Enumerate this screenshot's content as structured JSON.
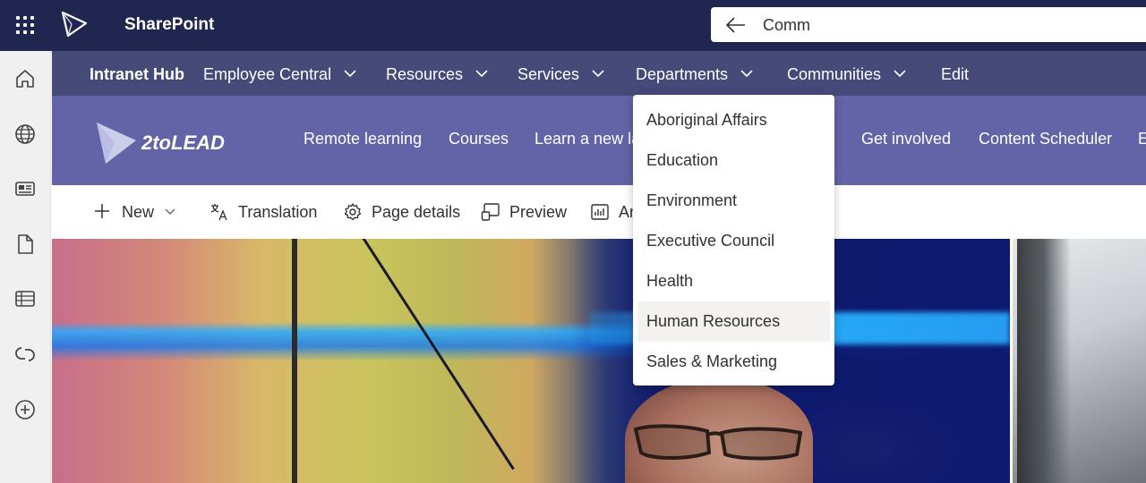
{
  "suite_bar": {
    "app_title": "SharePoint",
    "search_value": "Comm",
    "color": "#212650"
  },
  "app_bar": {
    "icons": [
      "home-icon",
      "globe-icon",
      "news-icon",
      "file-icon",
      "list-icon",
      "loop-icon",
      "add-circle-icon"
    ]
  },
  "hub_nav": {
    "title": "Intranet Hub",
    "items": [
      {
        "label": "Employee Central",
        "has_menu": true
      },
      {
        "label": "Resources",
        "has_menu": true
      },
      {
        "label": "Services",
        "has_menu": true
      },
      {
        "label": "Departments",
        "has_menu": true
      },
      {
        "label": "Communities",
        "has_menu": true
      },
      {
        "label": "Edit",
        "has_menu": false
      }
    ],
    "color": "#454a78"
  },
  "site_header": {
    "logo_text": "2toLEAD",
    "nav": [
      "Remote learning",
      "Courses",
      "Learn a new la",
      "Get involved",
      "Content Scheduler",
      "E"
    ],
    "color": "#6264a7"
  },
  "command_bar": {
    "new_label": "New",
    "translation_label": "Translation",
    "page_details_label": "Page details",
    "preview_label": "Preview",
    "analytics_label": "An"
  },
  "departments_menu": {
    "items": [
      "Aboriginal Affairs",
      "Education",
      "Environment",
      "Executive Council",
      "Health",
      "Human Resources",
      "Sales & Marketing"
    ],
    "hovered": "Human Resources"
  }
}
